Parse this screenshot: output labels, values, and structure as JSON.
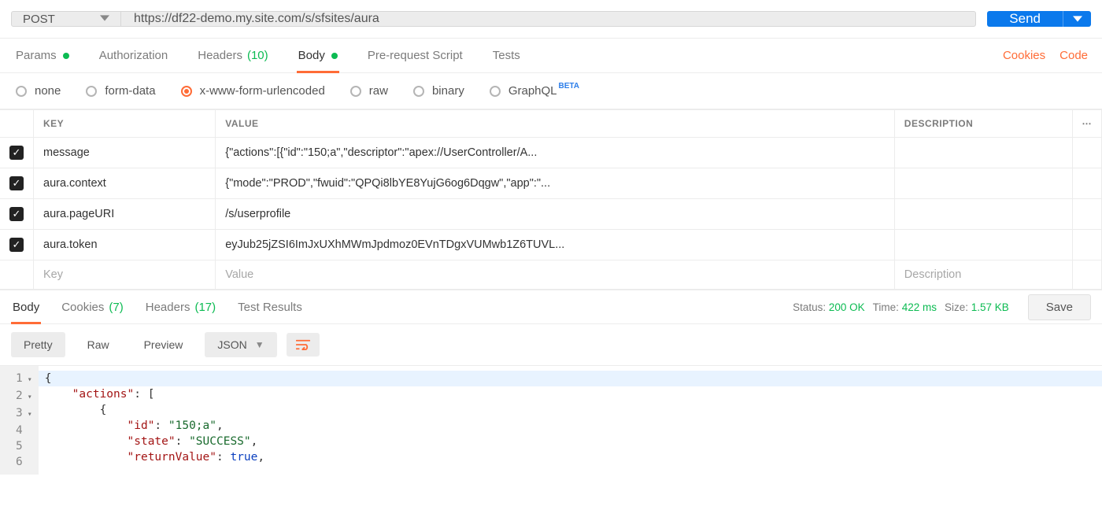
{
  "request": {
    "method": "POST",
    "url": "https://df22-demo.my.site.com/s/sfsites/aura",
    "send_label": "Send"
  },
  "request_tabs": {
    "params": "Params",
    "authorization": "Authorization",
    "headers": "Headers",
    "headers_count": "(10)",
    "body": "Body",
    "prerequest": "Pre-request Script",
    "tests": "Tests",
    "cookies": "Cookies",
    "code": "Code"
  },
  "body_types": {
    "none": "none",
    "formdata": "form-data",
    "urlencoded": "x-www-form-urlencoded",
    "raw": "raw",
    "binary": "binary",
    "graphql": "GraphQL",
    "beta": "BETA"
  },
  "kv_headers": {
    "key": "KEY",
    "value": "VALUE",
    "description": "DESCRIPTION"
  },
  "kv_rows": [
    {
      "key": "message",
      "value": "{\"actions\":[{\"id\":\"150;a\",\"descriptor\":\"apex://UserController/A...",
      "description": ""
    },
    {
      "key": "aura.context",
      "value": "{\"mode\":\"PROD\",\"fwuid\":\"QPQi8lbYE8YujG6og6Dqgw\",\"app\":\"...",
      "description": ""
    },
    {
      "key": "aura.pageURI",
      "value": "/s/userprofile",
      "description": ""
    },
    {
      "key": "aura.token",
      "value": "eyJub25jZSI6ImJxUXhMWmJpdmoz0EVnTDgxVUMwb1Z6TUVL...",
      "description": ""
    }
  ],
  "kv_placeholder": {
    "key": "Key",
    "value": "Value",
    "description": "Description"
  },
  "response_tabs": {
    "body": "Body",
    "cookies": "Cookies",
    "cookies_count": "(7)",
    "headers": "Headers",
    "headers_count": "(17)",
    "tests": "Test Results"
  },
  "response_meta": {
    "status_label": "Status:",
    "status_value": "200 OK",
    "time_label": "Time:",
    "time_value": "422 ms",
    "size_label": "Size:",
    "size_value": "1.57 KB",
    "save_label": "Save"
  },
  "resp_toolbar": {
    "pretty": "Pretty",
    "raw": "Raw",
    "preview": "Preview",
    "format": "JSON"
  },
  "json_lines_count": 6,
  "json": {
    "l1_open_brace": "{",
    "l2_key": "\"actions\"",
    "l2_rest": ": [",
    "l3_open": "{",
    "l4_key": "\"id\"",
    "l4_val": "\"150;a\"",
    "l5_key": "\"state\"",
    "l5_val": "\"SUCCESS\"",
    "l6_key": "\"returnValue\"",
    "l6_val": "true"
  }
}
